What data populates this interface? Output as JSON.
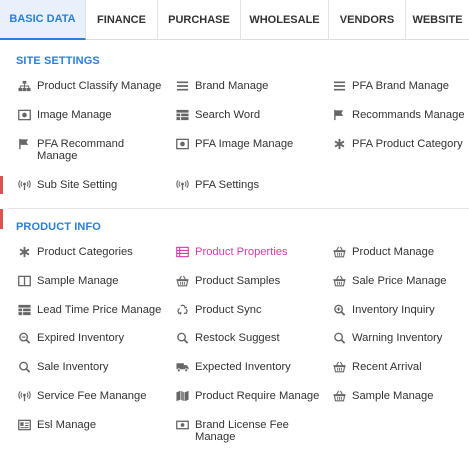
{
  "tabs": [
    {
      "label": "BASIC DATA",
      "active": true
    },
    {
      "label": "FINANCE",
      "active": false
    },
    {
      "label": "PURCHASE",
      "active": false
    },
    {
      "label": "WHOLESALE",
      "active": false
    },
    {
      "label": "VENDORS",
      "active": false
    },
    {
      "label": "WEBSITE",
      "active": false
    }
  ],
  "site_settings": {
    "title": "SITE SETTINGS",
    "items": [
      {
        "label": "Product Classify Manage",
        "icon": "sitemap-icon"
      },
      {
        "label": "Brand Manage",
        "icon": "list-icon"
      },
      {
        "label": "PFA Brand Manage",
        "icon": "list-icon"
      },
      {
        "label": "Image Manage",
        "icon": "image-icon"
      },
      {
        "label": "Search Word",
        "icon": "table-icon"
      },
      {
        "label": "Recommands Manage",
        "icon": "flag-icon"
      },
      {
        "label": "PFA Recommand Manage",
        "icon": "flag-icon"
      },
      {
        "label": "PFA Image Manage",
        "icon": "image-icon"
      },
      {
        "label": "PFA Product Category",
        "icon": "asterisk-icon"
      },
      {
        "label": "Sub Site Setting",
        "icon": "broadcast-icon"
      },
      {
        "label": "PFA Settings",
        "icon": "broadcast-icon"
      }
    ]
  },
  "product_info": {
    "title": "PRODUCT INFO",
    "items": [
      {
        "label": "Product Categories",
        "icon": "asterisk-icon"
      },
      {
        "label": "Product Properties",
        "icon": "properties-icon",
        "highlighted": true
      },
      {
        "label": "Product Manage",
        "icon": "basket-icon"
      },
      {
        "label": "Sample Manage",
        "icon": "columns-icon"
      },
      {
        "label": "Product Samples",
        "icon": "basket-icon"
      },
      {
        "label": "Sale Price Manage",
        "icon": "basket-icon"
      },
      {
        "label": "Lead Time Price Manage",
        "icon": "table-icon"
      },
      {
        "label": "Product Sync",
        "icon": "recycle-icon"
      },
      {
        "label": "Inventory Inquiry",
        "icon": "zoom-in-icon"
      },
      {
        "label": "Expired Inventory",
        "icon": "zoom-out-icon"
      },
      {
        "label": "Restock Suggest",
        "icon": "search-icon"
      },
      {
        "label": "Warning Inventory",
        "icon": "search-icon"
      },
      {
        "label": "Sale Inventory",
        "icon": "search-icon"
      },
      {
        "label": "Expected Inventory",
        "icon": "truck-icon"
      },
      {
        "label": "Recent Arrival",
        "icon": "basket-icon"
      },
      {
        "label": "Service Fee Manange",
        "icon": "broadcast-icon"
      },
      {
        "label": "Product Require Manage",
        "icon": "map-icon"
      },
      {
        "label": "Sample Manage",
        "icon": "basket-icon"
      },
      {
        "label": "Esl Manage",
        "icon": "id-card-icon"
      },
      {
        "label": "Brand License Fee Manage",
        "icon": "money-icon"
      }
    ]
  },
  "colors": {
    "accent": "#2b7fd6",
    "active_tab_bg": "#e8f1fb",
    "highlight": "#d63ca8",
    "left_strip": "#d9534f"
  }
}
